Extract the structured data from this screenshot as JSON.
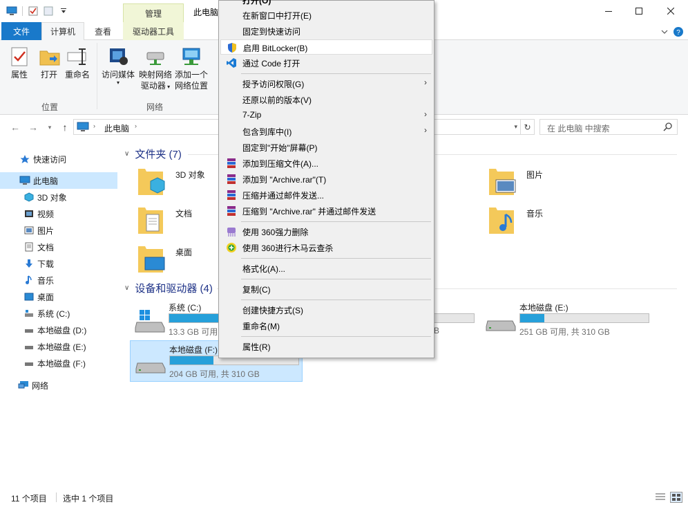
{
  "window": {
    "title": "此电脑",
    "manage_tab": "管理"
  },
  "tabs": {
    "file": "文件",
    "computer": "计算机",
    "view": "查看",
    "drive_tools": "驱动器工具"
  },
  "ribbon": {
    "properties": "属性",
    "open": "打开",
    "rename": "重命名",
    "access_media": "访问媒体",
    "map_drive_1": "映射网络",
    "map_drive_2": "驱动器",
    "add_location_1": "添加一个",
    "add_location_2": "网络位置",
    "group_location": "位置",
    "group_network": "网络"
  },
  "address": {
    "crumb": "此电脑",
    "search_placeholder": "在 此电脑 中搜索"
  },
  "sidebar": {
    "items": [
      {
        "label": "快速访问"
      },
      {
        "label": "此电脑"
      },
      {
        "label": "3D 对象"
      },
      {
        "label": "视频"
      },
      {
        "label": "图片"
      },
      {
        "label": "文档"
      },
      {
        "label": "下载"
      },
      {
        "label": "音乐"
      },
      {
        "label": "桌面"
      },
      {
        "label": "系统 (C:)"
      },
      {
        "label": "本地磁盘 (D:)"
      },
      {
        "label": "本地磁盘 (E:)"
      },
      {
        "label": "本地磁盘 (F:)"
      },
      {
        "label": "网络"
      }
    ]
  },
  "main": {
    "folders_header": "文件夹 (7)",
    "folders": [
      {
        "name": "3D 对象"
      },
      {
        "name": "图片"
      },
      {
        "name": "文档"
      },
      {
        "name": "音乐"
      },
      {
        "name": "桌面"
      }
    ],
    "drives_header": "设备和驱动器 (4)",
    "drives": [
      {
        "name": "系统 (C:)",
        "free": "13.3 GB 可用,",
        "used_pct": 75
      },
      {
        "name": "本地磁盘 (E:)",
        "free": "251 GB 可用, 共 310 GB",
        "used_pct": 19
      },
      {
        "name": "本地磁盘 (F:)",
        "free": "204 GB 可用, 共 310 GB",
        "used_pct": 34
      },
      {
        "name": "",
        "free": "B",
        "used_pct": 0
      }
    ]
  },
  "statusbar": {
    "count": "11 个项目",
    "selected": "选中 1 个项目"
  },
  "context_menu": {
    "items": [
      {
        "label": "打开(O)"
      },
      {
        "label": "在新窗口中打开(E)"
      },
      {
        "label": "固定到快速访问"
      },
      {
        "label": "启用 BitLocker(B)"
      },
      {
        "label": "通过 Code 打开"
      },
      {
        "label": "授予访问权限(G)"
      },
      {
        "label": "还原以前的版本(V)"
      },
      {
        "label": "7-Zip"
      },
      {
        "label": "包含到库中(I)"
      },
      {
        "label": "固定到\"开始\"屏幕(P)"
      },
      {
        "label": "添加到压缩文件(A)..."
      },
      {
        "label": "添加到 \"Archive.rar\"(T)"
      },
      {
        "label": "压缩并通过邮件发送..."
      },
      {
        "label": "压缩到 \"Archive.rar\" 并通过邮件发送"
      },
      {
        "label": "使用 360强力删除"
      },
      {
        "label": "使用 360进行木马云查杀"
      },
      {
        "label": "格式化(A)..."
      },
      {
        "label": "复制(C)"
      },
      {
        "label": "创建快捷方式(S)"
      },
      {
        "label": "重命名(M)"
      },
      {
        "label": "属性(R)"
      }
    ]
  },
  "colors": {
    "accent": "#1979ca",
    "selection": "#cce8ff",
    "bar_fill": "#26a0da"
  }
}
